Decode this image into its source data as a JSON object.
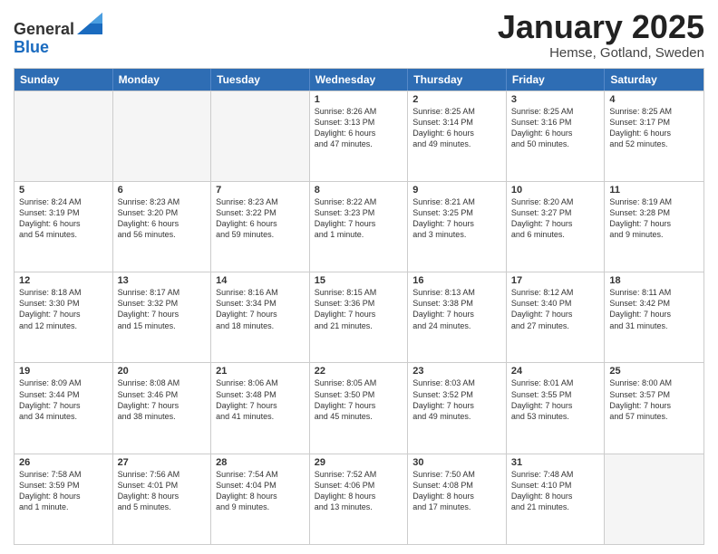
{
  "logo": {
    "general": "General",
    "blue": "Blue"
  },
  "title": "January 2025",
  "location": "Hemse, Gotland, Sweden",
  "weekdays": [
    "Sunday",
    "Monday",
    "Tuesday",
    "Wednesday",
    "Thursday",
    "Friday",
    "Saturday"
  ],
  "rows": [
    [
      {
        "day": "",
        "info": "",
        "empty": true
      },
      {
        "day": "",
        "info": "",
        "empty": true
      },
      {
        "day": "",
        "info": "",
        "empty": true
      },
      {
        "day": "1",
        "info": "Sunrise: 8:26 AM\nSunset: 3:13 PM\nDaylight: 6 hours\nand 47 minutes."
      },
      {
        "day": "2",
        "info": "Sunrise: 8:25 AM\nSunset: 3:14 PM\nDaylight: 6 hours\nand 49 minutes."
      },
      {
        "day": "3",
        "info": "Sunrise: 8:25 AM\nSunset: 3:16 PM\nDaylight: 6 hours\nand 50 minutes."
      },
      {
        "day": "4",
        "info": "Sunrise: 8:25 AM\nSunset: 3:17 PM\nDaylight: 6 hours\nand 52 minutes."
      }
    ],
    [
      {
        "day": "5",
        "info": "Sunrise: 8:24 AM\nSunset: 3:19 PM\nDaylight: 6 hours\nand 54 minutes."
      },
      {
        "day": "6",
        "info": "Sunrise: 8:23 AM\nSunset: 3:20 PM\nDaylight: 6 hours\nand 56 minutes."
      },
      {
        "day": "7",
        "info": "Sunrise: 8:23 AM\nSunset: 3:22 PM\nDaylight: 6 hours\nand 59 minutes."
      },
      {
        "day": "8",
        "info": "Sunrise: 8:22 AM\nSunset: 3:23 PM\nDaylight: 7 hours\nand 1 minute."
      },
      {
        "day": "9",
        "info": "Sunrise: 8:21 AM\nSunset: 3:25 PM\nDaylight: 7 hours\nand 3 minutes."
      },
      {
        "day": "10",
        "info": "Sunrise: 8:20 AM\nSunset: 3:27 PM\nDaylight: 7 hours\nand 6 minutes."
      },
      {
        "day": "11",
        "info": "Sunrise: 8:19 AM\nSunset: 3:28 PM\nDaylight: 7 hours\nand 9 minutes."
      }
    ],
    [
      {
        "day": "12",
        "info": "Sunrise: 8:18 AM\nSunset: 3:30 PM\nDaylight: 7 hours\nand 12 minutes."
      },
      {
        "day": "13",
        "info": "Sunrise: 8:17 AM\nSunset: 3:32 PM\nDaylight: 7 hours\nand 15 minutes."
      },
      {
        "day": "14",
        "info": "Sunrise: 8:16 AM\nSunset: 3:34 PM\nDaylight: 7 hours\nand 18 minutes."
      },
      {
        "day": "15",
        "info": "Sunrise: 8:15 AM\nSunset: 3:36 PM\nDaylight: 7 hours\nand 21 minutes."
      },
      {
        "day": "16",
        "info": "Sunrise: 8:13 AM\nSunset: 3:38 PM\nDaylight: 7 hours\nand 24 minutes."
      },
      {
        "day": "17",
        "info": "Sunrise: 8:12 AM\nSunset: 3:40 PM\nDaylight: 7 hours\nand 27 minutes."
      },
      {
        "day": "18",
        "info": "Sunrise: 8:11 AM\nSunset: 3:42 PM\nDaylight: 7 hours\nand 31 minutes."
      }
    ],
    [
      {
        "day": "19",
        "info": "Sunrise: 8:09 AM\nSunset: 3:44 PM\nDaylight: 7 hours\nand 34 minutes."
      },
      {
        "day": "20",
        "info": "Sunrise: 8:08 AM\nSunset: 3:46 PM\nDaylight: 7 hours\nand 38 minutes."
      },
      {
        "day": "21",
        "info": "Sunrise: 8:06 AM\nSunset: 3:48 PM\nDaylight: 7 hours\nand 41 minutes."
      },
      {
        "day": "22",
        "info": "Sunrise: 8:05 AM\nSunset: 3:50 PM\nDaylight: 7 hours\nand 45 minutes."
      },
      {
        "day": "23",
        "info": "Sunrise: 8:03 AM\nSunset: 3:52 PM\nDaylight: 7 hours\nand 49 minutes."
      },
      {
        "day": "24",
        "info": "Sunrise: 8:01 AM\nSunset: 3:55 PM\nDaylight: 7 hours\nand 53 minutes."
      },
      {
        "day": "25",
        "info": "Sunrise: 8:00 AM\nSunset: 3:57 PM\nDaylight: 7 hours\nand 57 minutes."
      }
    ],
    [
      {
        "day": "26",
        "info": "Sunrise: 7:58 AM\nSunset: 3:59 PM\nDaylight: 8 hours\nand 1 minute."
      },
      {
        "day": "27",
        "info": "Sunrise: 7:56 AM\nSunset: 4:01 PM\nDaylight: 8 hours\nand 5 minutes."
      },
      {
        "day": "28",
        "info": "Sunrise: 7:54 AM\nSunset: 4:04 PM\nDaylight: 8 hours\nand 9 minutes."
      },
      {
        "day": "29",
        "info": "Sunrise: 7:52 AM\nSunset: 4:06 PM\nDaylight: 8 hours\nand 13 minutes."
      },
      {
        "day": "30",
        "info": "Sunrise: 7:50 AM\nSunset: 4:08 PM\nDaylight: 8 hours\nand 17 minutes."
      },
      {
        "day": "31",
        "info": "Sunrise: 7:48 AM\nSunset: 4:10 PM\nDaylight: 8 hours\nand 21 minutes."
      },
      {
        "day": "",
        "info": "",
        "empty": true
      }
    ]
  ]
}
